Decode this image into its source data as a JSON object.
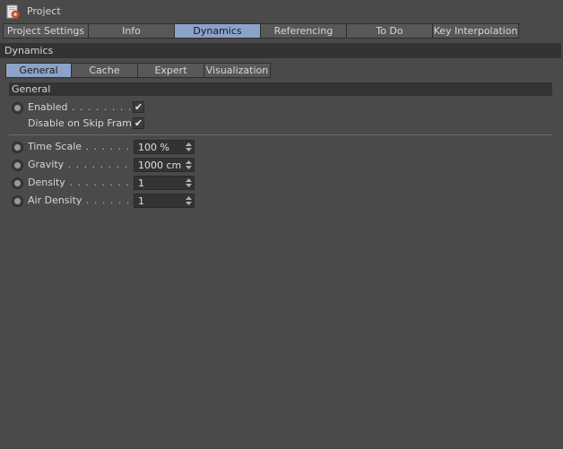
{
  "window": {
    "title": "Project"
  },
  "top_tabs": [
    {
      "label": "Project Settings",
      "active": false
    },
    {
      "label": "Info",
      "active": false
    },
    {
      "label": "Dynamics",
      "active": true
    },
    {
      "label": "Referencing",
      "active": false
    },
    {
      "label": "To Do",
      "active": false
    },
    {
      "label": "Key Interpolation",
      "active": false
    }
  ],
  "section": {
    "title": "Dynamics"
  },
  "sub_tabs": [
    {
      "label": "General",
      "active": true
    },
    {
      "label": "Cache",
      "active": false
    },
    {
      "label": "Expert",
      "active": false
    },
    {
      "label": "Visualization",
      "active": false
    }
  ],
  "group": {
    "title": "General"
  },
  "params": {
    "enabled": {
      "label": "Enabled",
      "dots": " . . . . . . . . . . . .",
      "checked": "✔"
    },
    "skip_frame": {
      "label": "Disable on Skip Frame",
      "checked": "✔"
    },
    "time_scale": {
      "label": "Time Scale",
      "dots": " . . . . . . . . . .",
      "value": "100 %"
    },
    "gravity": {
      "label": "Gravity",
      "dots": " . . . . . . . . . . . . .",
      "value": "1000 cm"
    },
    "density": {
      "label": "Density",
      "dots": " . . . . . . . . . . . .",
      "value": "1"
    },
    "air_density": {
      "label": "Air Density",
      "dots": " . . . . . . . . . .",
      "value": "1"
    }
  },
  "colors": {
    "active_tab": "#8ba3c8",
    "background": "#4a4a4a",
    "header_bar": "#333333"
  }
}
